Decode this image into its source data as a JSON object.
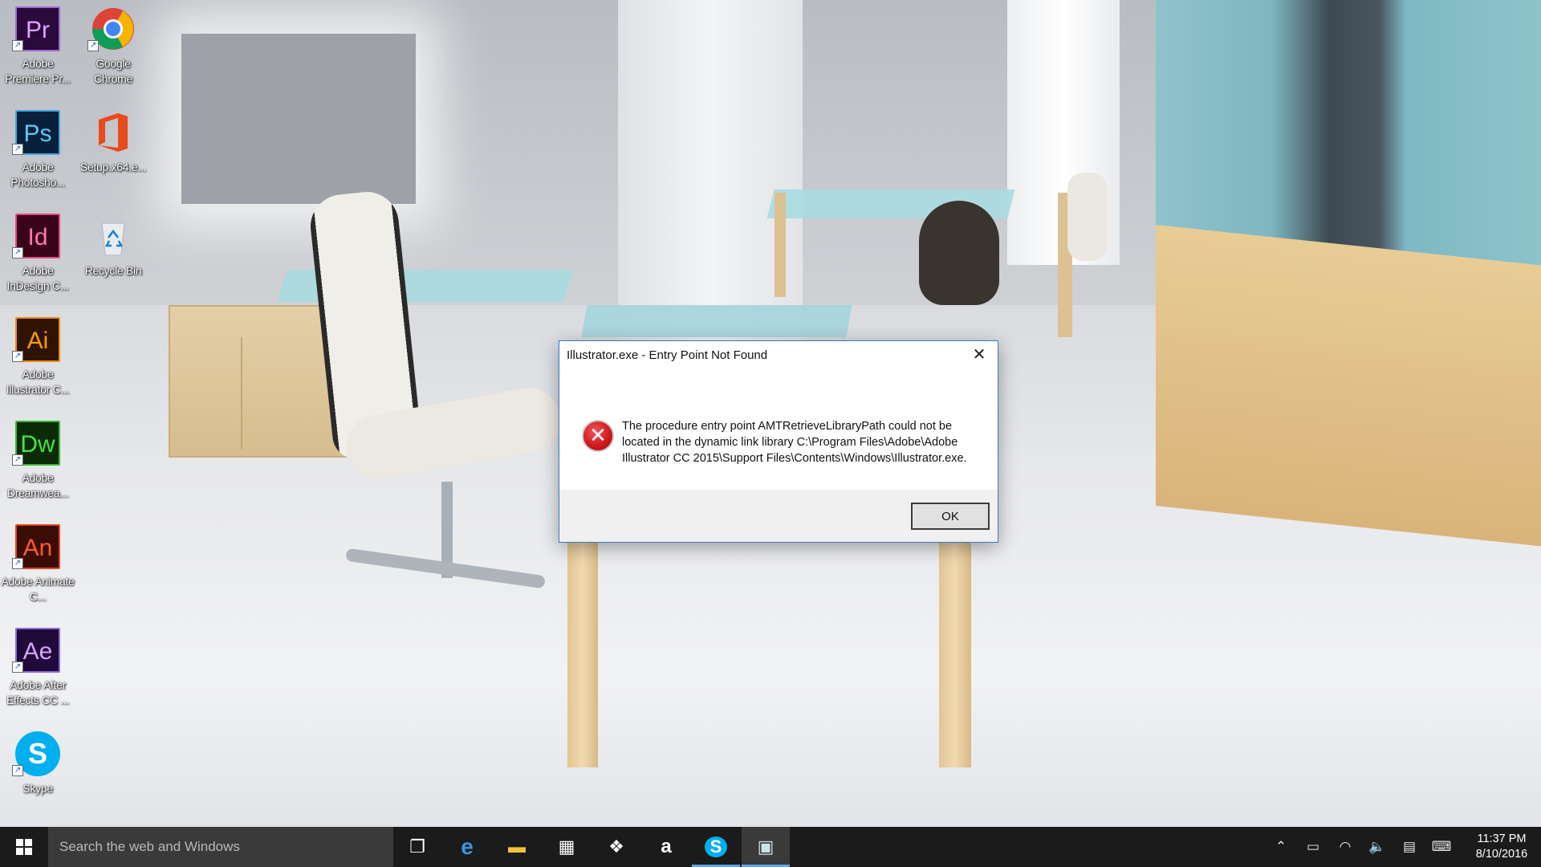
{
  "desktop": {
    "icons": [
      {
        "abbr": "Pr",
        "label": "Adobe Premiere Pr...",
        "icon": "premiere-icon",
        "fg": "#e1a4ff",
        "bg": "#2a0a3a",
        "border": "#9d6bd6"
      },
      {
        "abbr": "Ps",
        "label": "Adobe Photosho...",
        "icon": "photoshop-icon",
        "fg": "#5ec8f5",
        "bg": "#08203a",
        "border": "#3fa9e3"
      },
      {
        "abbr": "Id",
        "label": "Adobe InDesign C...",
        "icon": "indesign-icon",
        "fg": "#ff7aa8",
        "bg": "#3a0418",
        "border": "#e3497e"
      },
      {
        "abbr": "Ai",
        "label": "Adobe Illustrator C...",
        "icon": "illustrator-icon",
        "fg": "#ff9a00",
        "bg": "#2e1400",
        "border": "#ef8d00"
      },
      {
        "abbr": "Dw",
        "label": "Adobe Dreamwea...",
        "icon": "dreamweaver-icon",
        "fg": "#45e43d",
        "bg": "#0b2a07",
        "border": "#39b833"
      },
      {
        "abbr": "An",
        "label": "Adobe Animate C...",
        "icon": "animate-icon",
        "fg": "#ff5a2c",
        "bg": "#3a0c02",
        "border": "#e04a1d"
      },
      {
        "abbr": "Ae",
        "label": "Adobe After Effects CC ...",
        "icon": "after-effects-icon",
        "fg": "#d9a3ff",
        "bg": "#1f0a3a",
        "border": "#8f6bd6"
      },
      {
        "abbr": "S",
        "label": "Skype",
        "icon": "skype-icon",
        "fg": "#ffffff",
        "bg": "#00aff0",
        "border": "#00aff0"
      },
      {
        "abbr": "",
        "label": "Google Chrome",
        "icon": "chrome-icon"
      },
      {
        "abbr": "",
        "label": "Setup.x64.e...",
        "icon": "office-setup-icon"
      },
      {
        "abbr": "",
        "label": "Recycle Bin",
        "icon": "recycle-bin-icon"
      }
    ]
  },
  "dialog": {
    "title": "Illustrator.exe - Entry Point Not Found",
    "close_glyph": "✕",
    "error_glyph": "✕",
    "message": "The procedure entry point AMTRetrieveLibraryPath could not be located in the dynamic link library C:\\Program Files\\Adobe\\Adobe Illustrator CC 2015\\Support Files\\Contents\\Windows\\Illustrator.exe.",
    "ok_label": "OK"
  },
  "taskbar": {
    "search_placeholder": "Search the web and Windows",
    "apps": [
      {
        "icon": "task-view-icon",
        "glyph": "❐"
      },
      {
        "icon": "edge-icon",
        "glyph": "e"
      },
      {
        "icon": "file-explorer-icon",
        "glyph": "▬"
      },
      {
        "icon": "store-icon",
        "glyph": "▦"
      },
      {
        "icon": "dropbox-icon",
        "glyph": "❖"
      },
      {
        "icon": "amazon-icon",
        "glyph": "a"
      },
      {
        "icon": "skype-taskbar-icon",
        "glyph": "S"
      },
      {
        "icon": "active-window-icon",
        "glyph": "▣"
      }
    ],
    "tray": [
      {
        "icon": "show-hidden-icons-icon",
        "glyph": "⌃"
      },
      {
        "icon": "battery-icon",
        "glyph": "▭"
      },
      {
        "icon": "wifi-icon",
        "glyph": "◠"
      },
      {
        "icon": "volume-icon",
        "glyph": "🔈"
      },
      {
        "icon": "action-center-icon",
        "glyph": "▤"
      },
      {
        "icon": "keyboard-icon",
        "glyph": "⌨"
      }
    ],
    "time": "11:37 PM",
    "date": "8/10/2016"
  },
  "colors": {
    "taskbar": "#1b1b1b",
    "accent": "#5fa8e8",
    "dialog_border": "#3a7cc8",
    "error_red": "#d11a1e"
  }
}
